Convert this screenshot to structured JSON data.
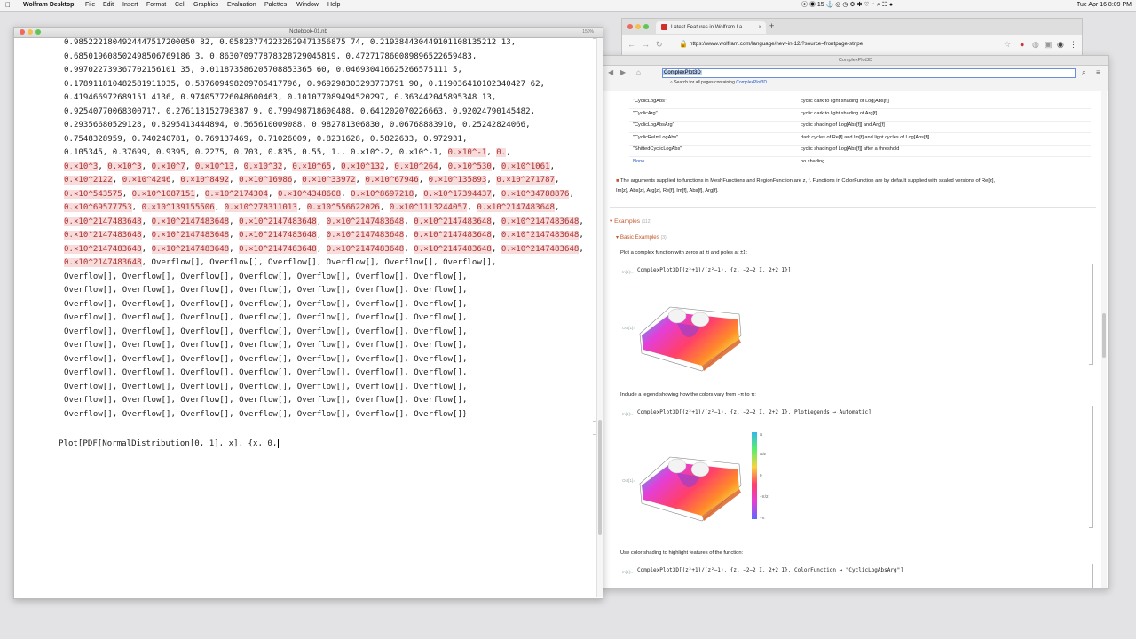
{
  "menubar": {
    "app": "Wolfram Desktop",
    "items": [
      "File",
      "Edit",
      "Insert",
      "Format",
      "Cell",
      "Graphics",
      "Evaluation",
      "Palettes",
      "Window",
      "Help"
    ],
    "status_count": "15",
    "clock": "Tue Apr 16  8:09 PM"
  },
  "notebook": {
    "title": "Notebook-01.nb",
    "zoom": "150%",
    "output_lines": [
      "0.9852221804924447517200050 82, 0.058237742232629471356875 74, 0.219384430449101108135212 13,",
      "0.685019608502498506769186 3, 0.863070977878328729045819, 0.472717860089896522659483,",
      "0.997022739367702156101 35, 0.011873586205708853365 60, 0.046930416625266575111 5,",
      "0.178911810482581911035, 0.587609498209706417796, 0.969298303293773791 90, 0.119036410102340427 62,",
      "0.419466972689151 4136, 0.974057726048600463, 0.101077089494520297, 0.363442045895348 13,",
      "0.92540770068300717, 0.276113152798387 9, 0.799498718600488, 0.641202070226663, 0.92024790145482,",
      "0.29356680529128, 0.8295413444894, 0.565610009088, 0.982781306830, 0.06768883910, 0.25242824066,",
      "0.7548328959, 0.740240781, 0.769137469, 0.71026009, 0.8231628, 0.5822633, 0.972931,",
      "0.105345, 0.37699, 0.9395, 0.2275, 0.703, 0.835, 0.55, 1., 0.×10^-2, 0.×10^-1,"
    ],
    "exp_rows": [
      [
        "0.×10^3",
        "0.×10^3",
        "0.×10^7",
        "0.×10^13",
        "0.×10^32",
        "0.×10^65",
        "0.×10^132",
        "0.×10^264",
        "0.×10^530",
        "0.×10^1061"
      ],
      [
        "0.×10^2122",
        "0.×10^4246",
        "0.×10^8492",
        "0.×10^16986",
        "0.×10^33972",
        "0.×10^67946",
        "0.×10^135893",
        "0.×10^271787"
      ],
      [
        "0.×10^543575",
        "0.×10^1087151",
        "0.×10^2174304",
        "0.×10^4348608",
        "0.×10^8697218",
        "0.×10^17394437",
        "0.×10^34788876"
      ],
      [
        "0.×10^69577753",
        "0.×10^139155506",
        "0.×10^278311013",
        "0.×10^556622026",
        "0.×10^1113244057",
        "0.×10^2147483648"
      ],
      [
        "0.×10^2147483648",
        "0.×10^2147483648",
        "0.×10^2147483648",
        "0.×10^2147483648",
        "0.×10^2147483648",
        "0.×10^2147483648"
      ],
      [
        "0.×10^2147483648",
        "0.×10^2147483648",
        "0.×10^2147483648",
        "0.×10^2147483648",
        "0.×10^2147483648",
        "0.×10^2147483648"
      ],
      [
        "0.×10^2147483648",
        "0.×10^2147483648",
        "0.×10^2147483648",
        "0.×10^2147483648",
        "0.×10^2147483648",
        "0.×10^2147483648"
      ]
    ],
    "overflow_first": "0.×10^2147483648",
    "overflow_word": "Overflow[]",
    "input_line": "Plot[PDF[NormalDistribution[0, 1], x], {x, 0,"
  },
  "browser": {
    "tab_title": "Latest Features in Wolfram La",
    "url": "https://www.wolfram.com/language/new-in-12/?source=frontpage-stripe"
  },
  "doc": {
    "window_title": "ComplexPlot3D",
    "search_value": "ComplexPlot3D",
    "search_all_prefix": "Search for all pages containing",
    "search_all_term": "ComplexPlot3D",
    "options": [
      {
        "name": "\"CyclicLogAbs\"",
        "desc": "cyclic dark to light shading of Log[Abs[f]]"
      },
      {
        "name": "\"CyclicArg\"",
        "desc": "cyclic dark to light shading of Arg[f]"
      },
      {
        "name": "\"CyclicLogAbsArg\"",
        "desc": "cyclic shading of Log[Abs[f]] and Arg[f]"
      },
      {
        "name": "\"CyclicReImLogAbs\"",
        "desc": "dark cycles of Re[f] and Im[f] and light cycles of Log[Abs[f]]"
      },
      {
        "name": "\"ShiftedCyclicLogAbs\"",
        "desc": "cyclic shading of Log[Abs[f]] after a threshold"
      },
      {
        "name": "None",
        "desc": "no shading"
      }
    ],
    "bullet_line1": "The arguments supplied to functions in MeshFunctions and RegionFunction are z, f. Functions in ColorFunction are by default supplied with scaled versions of Re[z],",
    "bullet_line2": "Im[z], Abs[z], Arg[z], Re[f], Im[f], Abs[f], Arg[f].",
    "examples_label": "Examples",
    "examples_count": "(112)",
    "basic_label": "Basic Examples",
    "basic_count": "(3)",
    "ex1_text": "Plot a complex function with zeros at ±i and poles at ±1:",
    "ex1_code": "ComplexPlot3D[(z²+1)/(z²−1), {z, −2−2 I, 2+2 I}]",
    "ex2_text": "Include a legend showing how the colors vary from −π to π:",
    "ex2_code": "ComplexPlot3D[(z²+1)/(z²−1), {z, −2−2 I, 2+2 I}, PlotLegends → Automatic]",
    "ex3_text": "Use color shading to highlight features of the function:",
    "ex3_code": "ComplexPlot3D[(z²+1)/(z²−1), {z, −2−2 I, 2+2 I}, ColorFunction → \"CyclicLogAbsArg\"]",
    "in_label": "In[1]:=",
    "out_label": "Out[1]=",
    "legend_ticks": [
      "π",
      "π/2",
      "0",
      "−π/2",
      "−π"
    ]
  },
  "colors": {
    "accent": "#c2572c",
    "link": "#2a58c2",
    "highlight": "#f8dcdc"
  }
}
